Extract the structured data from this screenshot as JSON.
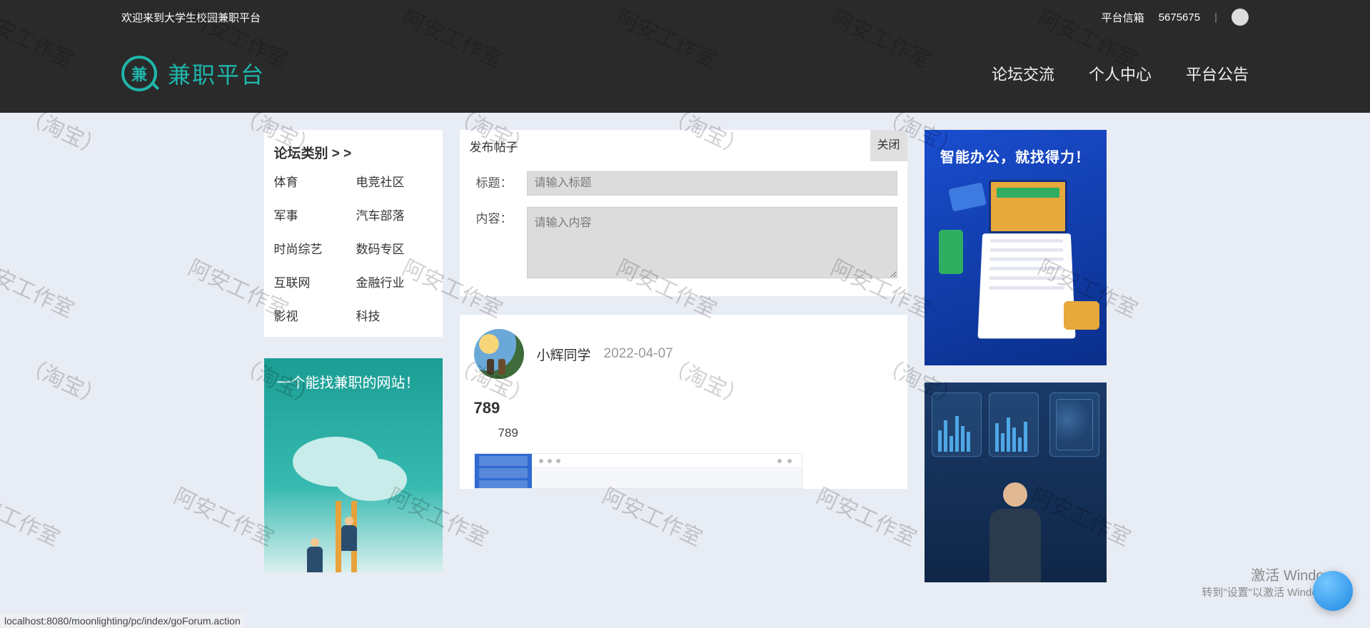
{
  "topbar": {
    "welcome": "欢迎来到大学生校园兼职平台",
    "mailbox": "平台信箱",
    "userNumber": "5675675"
  },
  "brand": {
    "iconGlyph": "兼",
    "name": "兼职平台"
  },
  "nav": {
    "forum": "论坛交流",
    "personal": "个人中心",
    "announce": "平台公告"
  },
  "categories": {
    "title": "论坛类别 > >",
    "items": [
      "体育",
      "电竞社区",
      "军事",
      "汽车部落",
      "时尚综艺",
      "数码专区",
      "互联网",
      "金融行业",
      "影视",
      "科技"
    ]
  },
  "promoLeft": {
    "title": "一个能找兼职的网站！"
  },
  "postBox": {
    "header": "发布帖子",
    "close": "关闭",
    "titleLabel": "标题：",
    "titlePlaceholder": "请输入标题",
    "contentLabel": "内容：",
    "contentPlaceholder": "请输入内容"
  },
  "thread": {
    "user": "小辉同学",
    "date": "2022-04-07",
    "title": "789",
    "snippet": "789"
  },
  "promoRight1": {
    "title": "智能办公，就找得力！"
  },
  "windows": {
    "line1": "激活 Windows",
    "line2": "转到\"设置\"以激活 Windows。"
  },
  "status": "localhost:8080/moonlighting/pc/index/goForum.action"
}
